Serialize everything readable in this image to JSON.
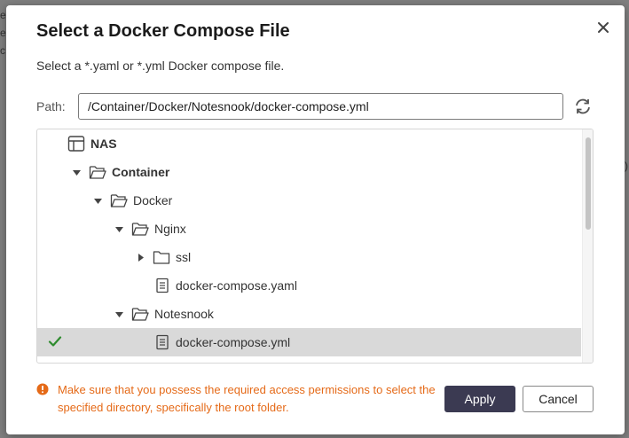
{
  "dialog": {
    "title": "Select a Docker Compose File",
    "subtitle": "Select a *.yaml or *.yml Docker compose file.",
    "path_label": "Path:",
    "path_value": "/Container/Docker/Notesnook/docker-compose.yml"
  },
  "tree": {
    "rows": [
      {
        "label": "NAS",
        "icon": "nas-icon",
        "caret": "none"
      },
      {
        "label": "Container",
        "icon": "folder-open-icon",
        "caret": "expanded"
      },
      {
        "label": "Docker",
        "icon": "folder-open-icon",
        "caret": "expanded"
      },
      {
        "label": "Nginx",
        "icon": "folder-open-icon",
        "caret": "expanded"
      },
      {
        "label": "ssl",
        "icon": "folder-icon",
        "caret": "collapsed"
      },
      {
        "label": "docker-compose.yaml",
        "icon": "file-icon",
        "caret": "none"
      },
      {
        "label": "Notesnook",
        "icon": "folder-open-icon",
        "caret": "expanded"
      },
      {
        "label": "docker-compose.yml",
        "icon": "file-icon",
        "caret": "none",
        "selected": true
      }
    ]
  },
  "footer": {
    "warning": "Make sure that you possess the required access permissions to select the specified directory, specifically the root folder.",
    "apply_label": "Apply",
    "cancel_label": "Cancel"
  },
  "colors": {
    "apply_bg": "#3b3a52",
    "warning": "#e56a18",
    "check": "#2e8b2e",
    "selected_row": "#d9d9d9"
  },
  "background": {
    "fragments": [
      "e",
      "e",
      "c",
      ")"
    ]
  }
}
